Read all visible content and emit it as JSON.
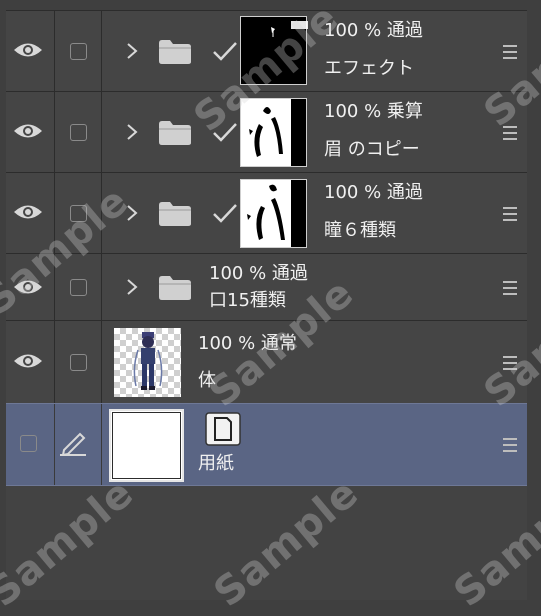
{
  "layers": [
    {
      "opacity_blend": "100 % 通過",
      "name": "エフェクト",
      "thumbnail": "black-fill-with-mark"
    },
    {
      "opacity_blend": "100 % 乗算",
      "name": "眉 のコピー",
      "thumbnail": "white-figure-black-edge"
    },
    {
      "opacity_blend": "100 % 通過",
      "name": "瞳６種類",
      "thumbnail": "white-figure-black-edge"
    },
    {
      "opacity_blend": "100 % 通過",
      "name": "口15種類",
      "thumbnail": ""
    },
    {
      "opacity_blend": "100 % 通常",
      "name": "体",
      "thumbnail": "character-on-transparent"
    },
    {
      "opacity_blend": "",
      "name": "用紙",
      "thumbnail": "white-paper"
    }
  ],
  "watermark_text": "Sample",
  "colors": {
    "panel_bg": "#3f3f3f",
    "row_bg": "#454545",
    "selected_row_bg": "#5a6584"
  },
  "icons": [
    "eye-icon",
    "pen-icon",
    "folder-icon",
    "checkmark-icon",
    "chevron-right-icon",
    "paper-icon",
    "menu-icon"
  ]
}
